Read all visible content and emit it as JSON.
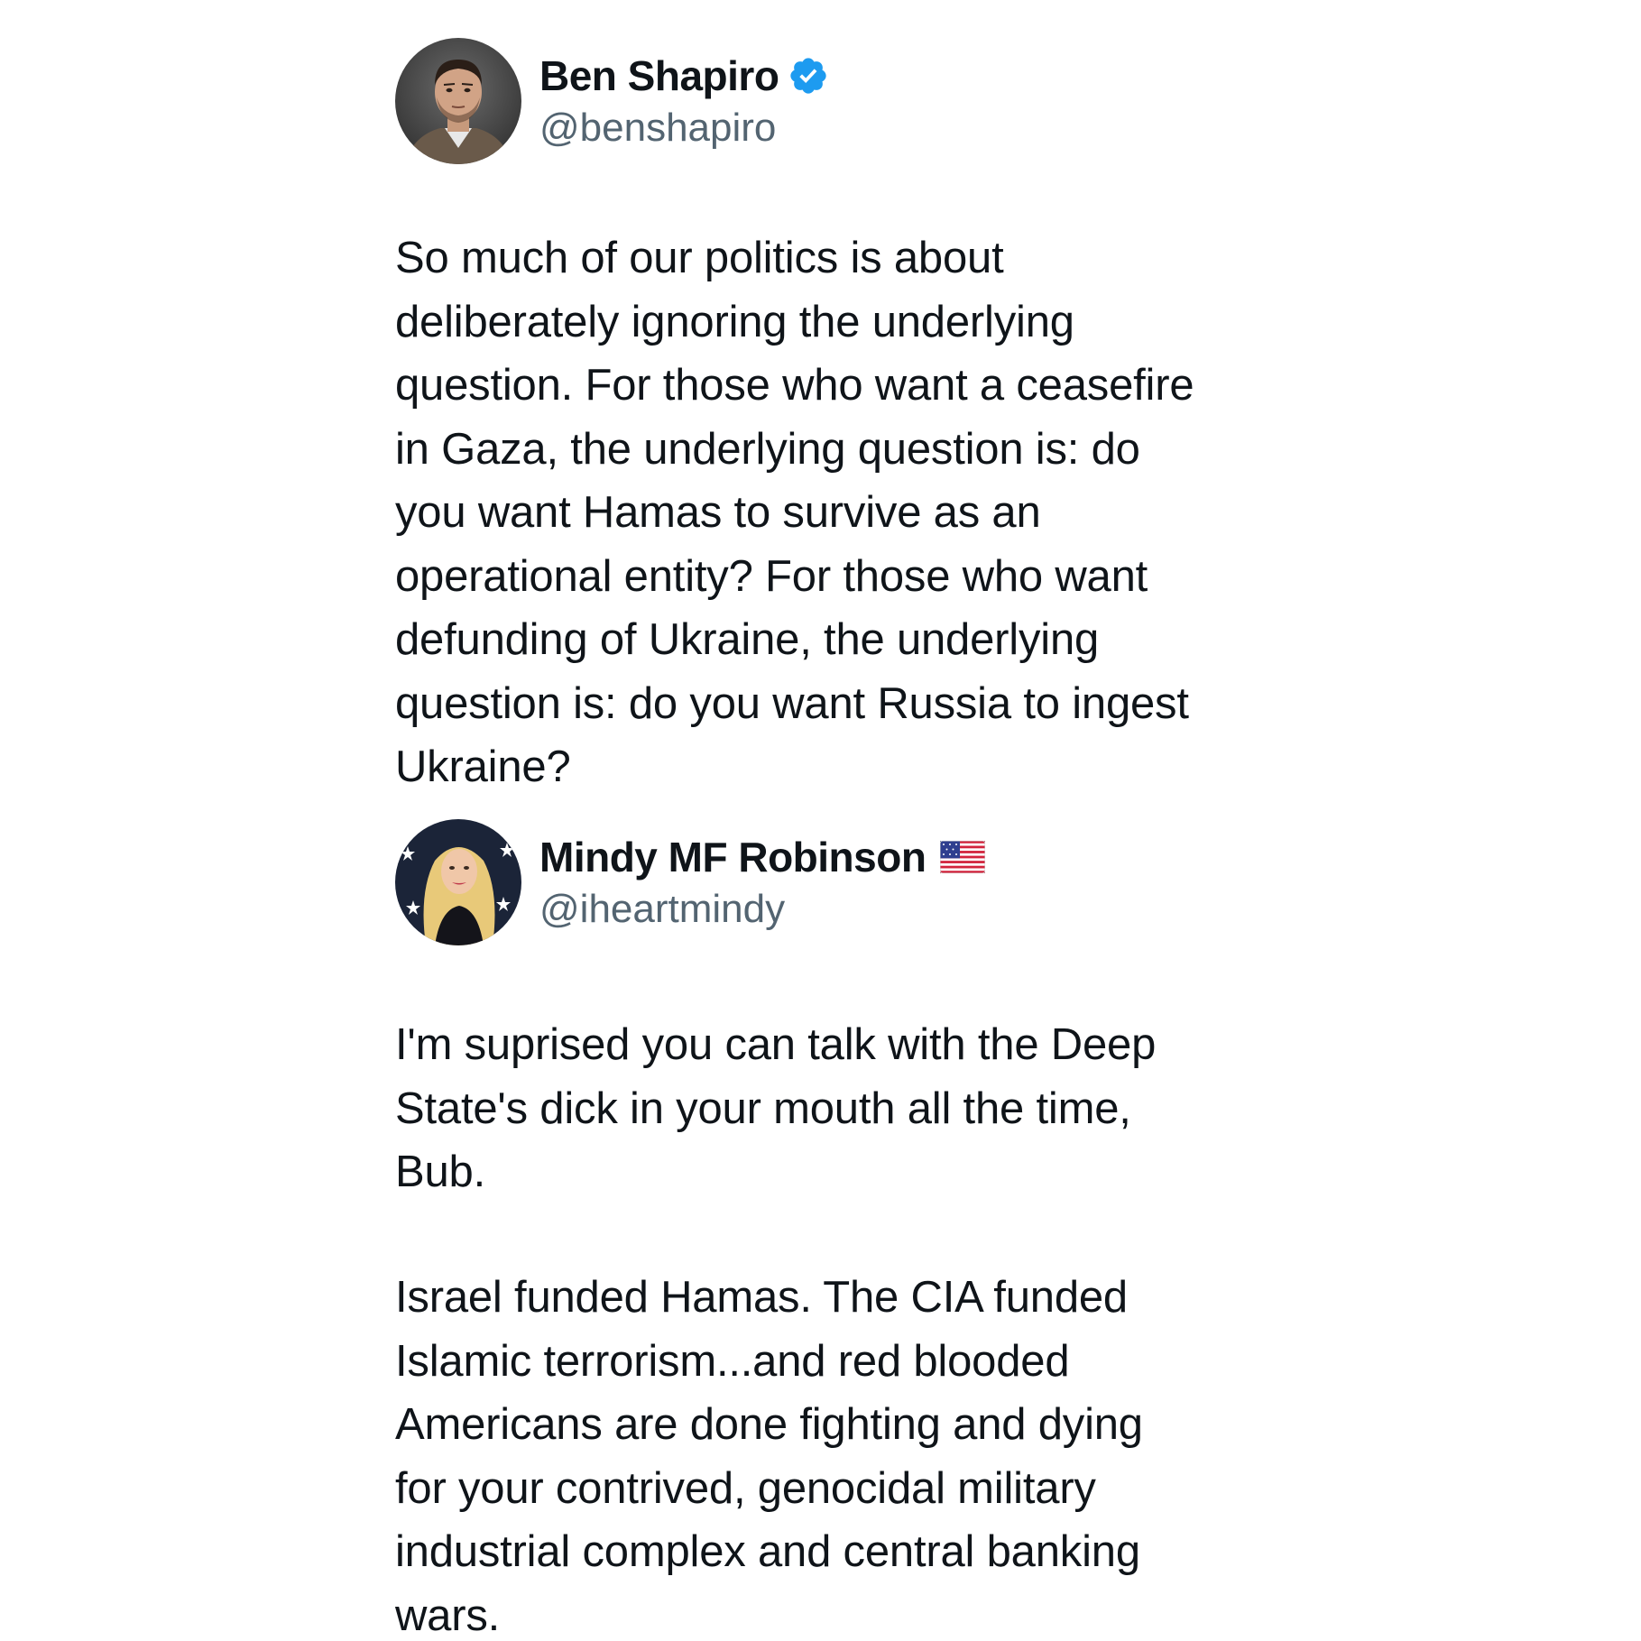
{
  "posts": [
    {
      "author": {
        "display_name": "Ben Shapiro",
        "handle": "@benshapiro",
        "verified_icon": "verified-badge-icon",
        "avatar": "profile-photo-man"
      },
      "text": "So much of our politics is about\ndeliberately ignoring the underlying\nquestion. For those who want a ceasefire\nin Gaza, the underlying question is: do\nyou want Hamas to survive as an\noperational entity? For those who want\ndefunding of Ukraine, the underlying\nquestion is: do you want Russia to ingest\nUkraine?"
    },
    {
      "author": {
        "display_name": "Mindy MF Robinson",
        "handle": "@iheartmindy",
        "name_emoji": "us-flag-icon",
        "avatar": "profile-photo-woman"
      },
      "text_paragraphs": [
        "I'm suprised you can talk with the Deep\nState's dick in your mouth all the time,\nBub.",
        "Israel funded Hamas. The CIA funded\nIslamic terrorism...and red blooded\nAmericans are done fighting and dying\nfor your contrived, genocidal military\nindustrial complex and central banking\nwars."
      ]
    }
  ],
  "colors": {
    "text": "#0f1419",
    "secondary_text": "#536471",
    "verified_blue": "#1d9bf0",
    "background": "#ffffff"
  }
}
